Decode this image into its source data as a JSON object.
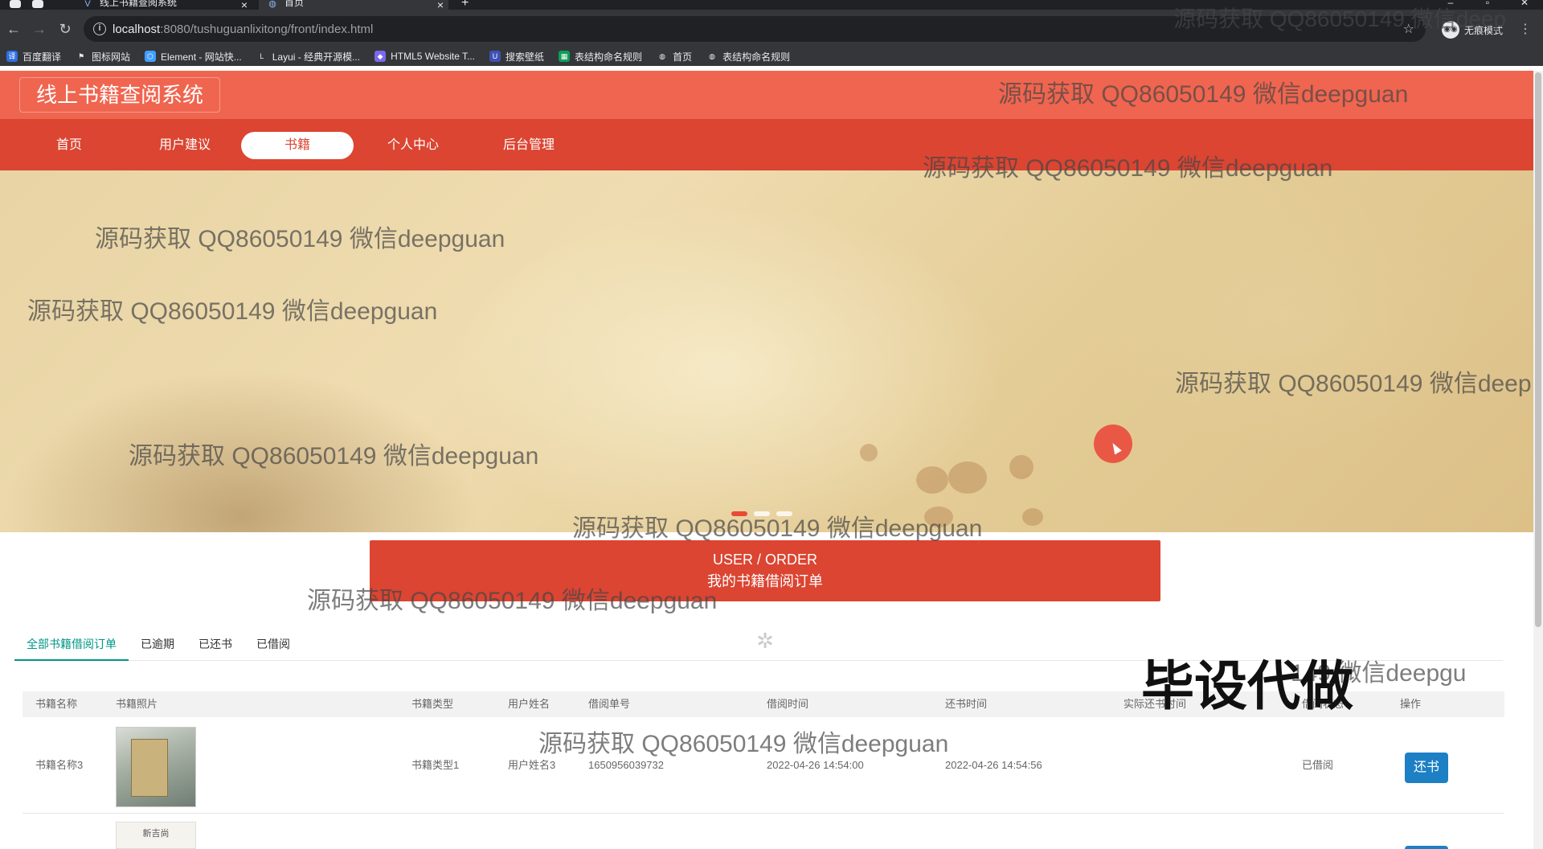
{
  "browser": {
    "tabs": [
      {
        "title": "线上书籍查阅系统",
        "active": false
      },
      {
        "title": "首页",
        "active": true
      }
    ],
    "address": {
      "host": "localhost",
      "path": ":8080/tushuguanlixitong/front/index.html"
    },
    "incognito_label": "无痕模式",
    "bookmarks": [
      {
        "label": "百度翻译",
        "icon": "translate-icon",
        "color": "#2f6fe0"
      },
      {
        "label": "图标网站",
        "icon": "flag-icon",
        "color": "#ffffff"
      },
      {
        "label": "Element - 网站快...",
        "icon": "element-icon",
        "color": "#409eff"
      },
      {
        "label": "Layui - 经典开源模...",
        "icon": "layui-icon",
        "color": "#ffffff"
      },
      {
        "label": "HTML5 Website T...",
        "icon": "html5-icon",
        "color": "#7b68ee"
      },
      {
        "label": "搜索壁纸",
        "icon": "wallpaper-icon",
        "color": "#3f51b5"
      },
      {
        "label": "表结构命名规则",
        "icon": "sheet-icon",
        "color": "#0f9d58"
      },
      {
        "label": "首页",
        "icon": "globe-icon",
        "color": "#e8eaed"
      },
      {
        "label": "表结构命名规则",
        "icon": "globe-icon",
        "color": "#e8eaed"
      }
    ]
  },
  "site": {
    "title": "线上书籍查阅系统",
    "nav": [
      {
        "label": "首页",
        "active": false
      },
      {
        "label": "用户建议",
        "active": false
      },
      {
        "label": "书籍",
        "active": true
      },
      {
        "label": "个人中心",
        "active": false
      },
      {
        "label": "后台管理",
        "active": false
      }
    ],
    "colors": {
      "header": "#f0654f",
      "nav": "#db4532",
      "tab_active": "#009688",
      "button": "#1d7fc4"
    }
  },
  "order_section": {
    "title_en": "USER / ORDER",
    "title_zh": "我的书籍借阅订单",
    "tabs": [
      "全部书籍借阅订单",
      "已逾期",
      "已还书",
      "已借阅"
    ],
    "active_tab": 0,
    "columns": [
      "书籍名称",
      "书籍照片",
      "书籍类型",
      "用户姓名",
      "借阅单号",
      "借阅时间",
      "还书时间",
      "实际还书时间",
      "借阅状态",
      "操作"
    ],
    "rows": [
      {
        "book_name": "书籍名称3",
        "book_type": "书籍类型1",
        "user_name": "用户姓名3",
        "order_no": "1650956039732",
        "borrow_time": "2022-04-26 14:54:00",
        "return_time": "2022-04-26 14:54:56",
        "actual_return_time": "",
        "status": "已借阅",
        "action": "还书"
      }
    ],
    "row2_img_text": "新吉尚"
  },
  "watermarks": {
    "text": "源码获取 QQ86050149 微信deepguan",
    "cut": "源码获取 QQ86050149 微信deep",
    "tail": "149 微信deepgu",
    "big": "毕设代做"
  }
}
